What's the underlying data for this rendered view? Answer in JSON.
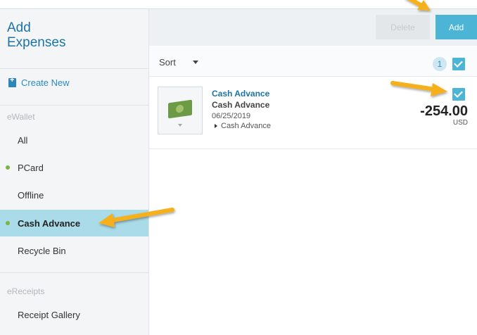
{
  "sidebar": {
    "title_line1": "Add",
    "title_line2": "Expenses",
    "create_new": "Create New",
    "ewallet_section": "eWallet",
    "items": [
      {
        "label": "All"
      },
      {
        "label": "PCard"
      },
      {
        "label": "Offline"
      },
      {
        "label": "Cash Advance"
      },
      {
        "label": "Recycle Bin"
      }
    ],
    "ereceipts_section": "eReceipts",
    "receipt_gallery": "Receipt Gallery"
  },
  "toolbar": {
    "delete_label": "Delete",
    "add_label": "Add"
  },
  "sortbar": {
    "sort_label": "Sort",
    "selected_count": "1"
  },
  "expense": {
    "title": "Cash Advance",
    "subtitle": "Cash Advance",
    "date": "06/25/2019",
    "type": "Cash Advance",
    "amount": "-254.00",
    "currency": "USD"
  },
  "colors": {
    "accent": "#4cb5d6",
    "link": "#1d73a6",
    "active_bg": "#a9dbe8",
    "status_dot": "#7cb342",
    "arrow": "#f5b01a"
  }
}
